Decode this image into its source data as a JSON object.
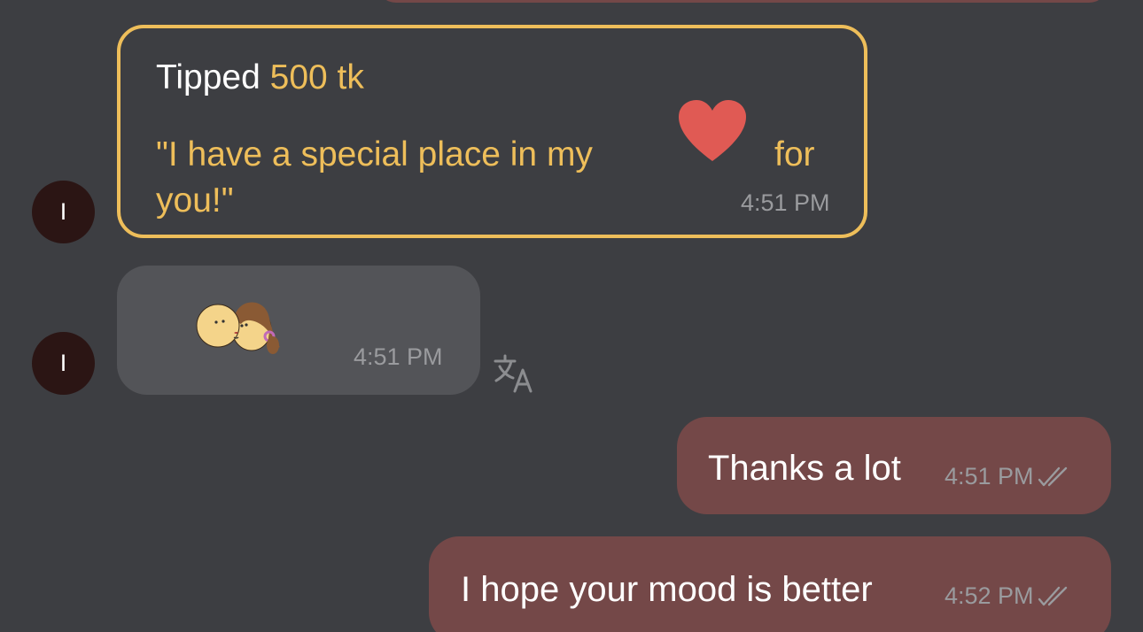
{
  "contact": {
    "avatar_initial": "I"
  },
  "messages": {
    "tip": {
      "prefix": "Tipped",
      "amount": "500 tk",
      "text_part1": "\"I have a special place in my",
      "text_part2": "for",
      "text_part3": "you!\"",
      "emoji": "heart-icon",
      "time": "4:51 PM"
    },
    "sticker": {
      "emoji": "kiss-sticker",
      "time": "4:51 PM"
    },
    "outgoing": [
      {
        "text": "Thanks a lot",
        "time": "4:51 PM",
        "status": "read"
      },
      {
        "text": "I hope your mood is better",
        "time": "4:52 PM",
        "status": "read"
      }
    ]
  },
  "colors": {
    "background": "#3d3e42",
    "accent_gold": "#eebe5a",
    "outgoing_bubble": "#744848",
    "incoming_bubble": "#535458",
    "avatar": "#2b1514",
    "heart": "#e05a54"
  }
}
